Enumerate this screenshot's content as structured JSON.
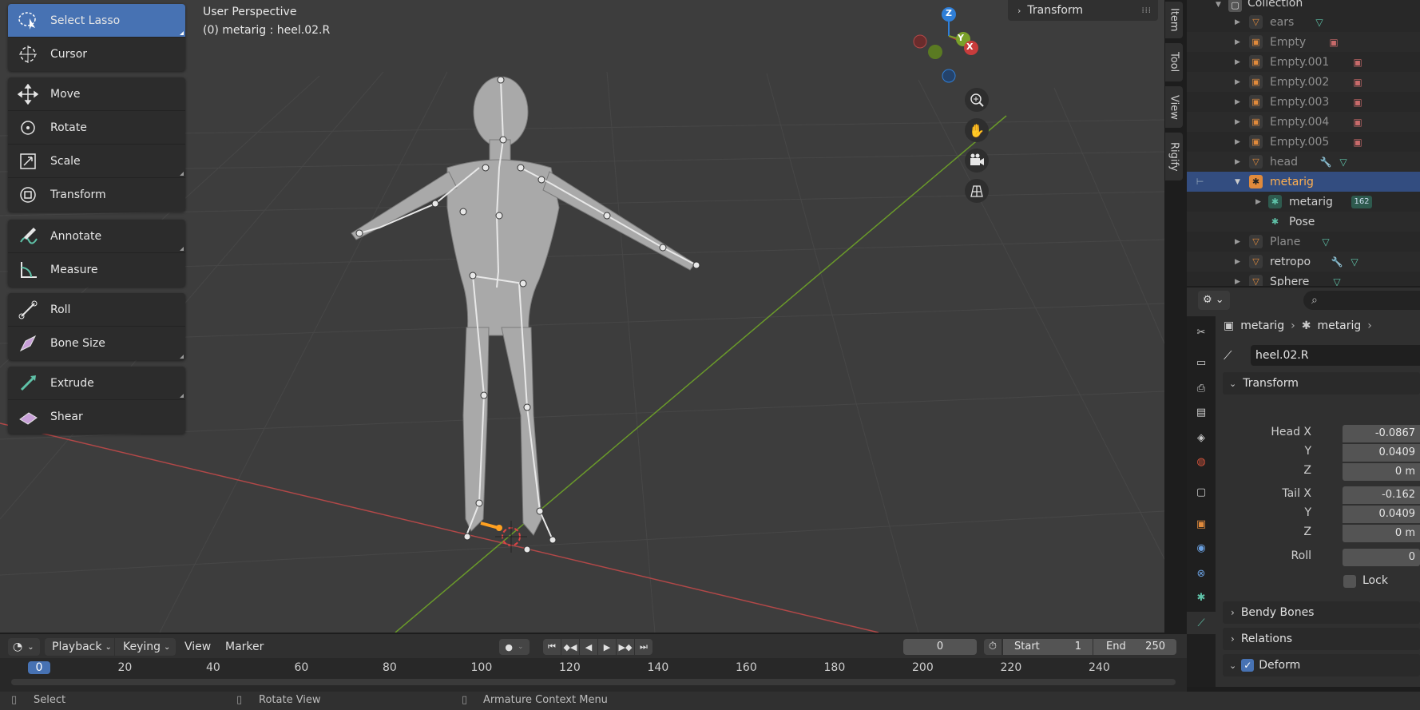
{
  "viewport": {
    "title": "User Perspective",
    "subtitle": "(0) metarig : heel.02.R"
  },
  "toolbar": {
    "select_lasso": "Select Lasso",
    "cursor": "Cursor",
    "move": "Move",
    "rotate": "Rotate",
    "scale": "Scale",
    "transform": "Transform",
    "annotate": "Annotate",
    "measure": "Measure",
    "roll": "Roll",
    "bone_size": "Bone Size",
    "extrude": "Extrude",
    "shear": "Shear"
  },
  "npanel": {
    "header": "Transform",
    "tabs": [
      "Item",
      "Tool",
      "View",
      "Rigify"
    ]
  },
  "gizmo": {
    "z": "Z",
    "y": "Y",
    "x": "X"
  },
  "outliner": {
    "collection": "Collection",
    "rows": [
      {
        "name": "ears"
      },
      {
        "name": "Empty"
      },
      {
        "name": "Empty.001"
      },
      {
        "name": "Empty.002"
      },
      {
        "name": "Empty.003"
      },
      {
        "name": "Empty.004"
      },
      {
        "name": "Empty.005"
      },
      {
        "name": "head"
      },
      {
        "name": "metarig"
      },
      {
        "name": "metarig",
        "badge": "162"
      },
      {
        "name": "Pose"
      },
      {
        "name": "Plane"
      },
      {
        "name": "retropo"
      },
      {
        "name": "Sphere"
      }
    ]
  },
  "properties": {
    "breadcrumb": [
      "metarig",
      "metarig"
    ],
    "bone_name": "heel.02.R",
    "transform_header": "Transform",
    "head_x_label": "Head X",
    "head_x": "-0.0867",
    "head_y_label": "Y",
    "head_y": "0.0409",
    "head_z_label": "Z",
    "head_z": "0 m",
    "tail_x_label": "Tail X",
    "tail_x": "-0.162",
    "tail_y_label": "Y",
    "tail_y": "0.0409",
    "tail_z_label": "Z",
    "tail_z": "0 m",
    "roll_label": "Roll",
    "roll": "0",
    "lock_label": "Lock",
    "bendy_bones": "Bendy Bones",
    "relations": "Relations",
    "deform": "Deform"
  },
  "timeline": {
    "playback": "Playback",
    "keying": "Keying",
    "view": "View",
    "marker": "Marker",
    "current_frame": "0",
    "start_label": "Start",
    "start": "1",
    "end_label": "End",
    "end": "250",
    "ruler": [
      "0",
      "20",
      "40",
      "60",
      "80",
      "100",
      "120",
      "140",
      "160",
      "180",
      "200",
      "220",
      "240"
    ]
  },
  "status": {
    "select": "Select",
    "rotate_view": "Rotate View",
    "context_menu": "Armature Context Menu"
  },
  "colors": {
    "accent": "#4772b3",
    "active_bone": "#ffa020",
    "x_axis": "#c83c3c",
    "y_axis": "#7aa02a",
    "z_axis": "#2f7fd8",
    "selected_row": "#334d80"
  }
}
